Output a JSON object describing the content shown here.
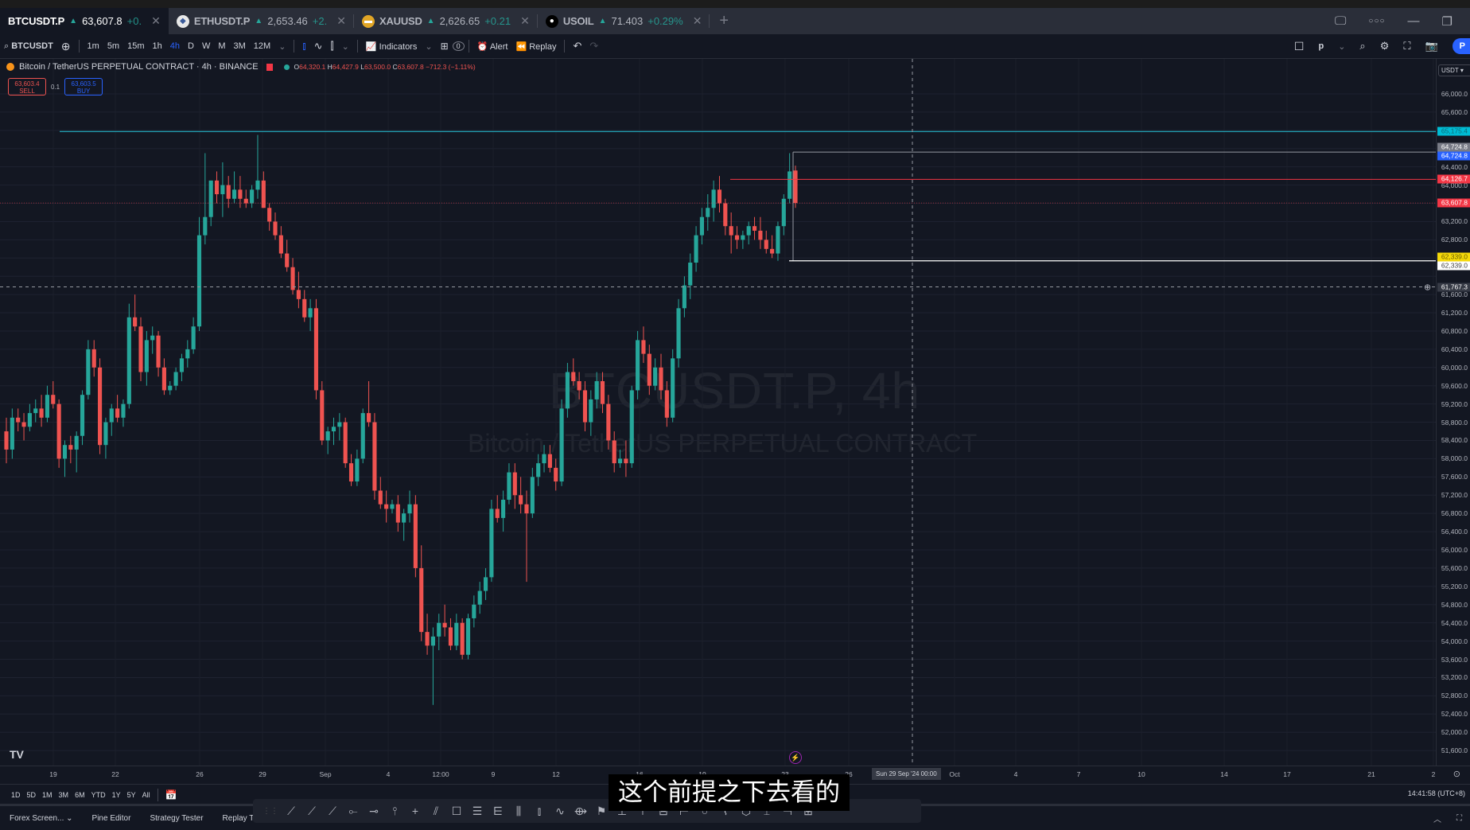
{
  "tabs": [
    {
      "symbol": "BTCUSDT.P",
      "price": "63,607.8",
      "change": "+0.",
      "active": true,
      "icon": "bitcoin-icon"
    },
    {
      "symbol": "ETHUSDT.P",
      "price": "2,653.46",
      "change": "+2.",
      "active": false,
      "icon": "ethereum-icon"
    },
    {
      "symbol": "XAUUSD",
      "price": "2,626.65",
      "change": "+0.21",
      "active": false,
      "icon": "gold-icon"
    },
    {
      "symbol": "USOIL",
      "price": "71.403",
      "change": "+0.29%",
      "active": false,
      "icon": "oil-drop-icon"
    }
  ],
  "toolbar": {
    "symbol_search": "BTCUSDT",
    "intervals": [
      "1m",
      "5m",
      "15m",
      "1h",
      "4h",
      "D",
      "W",
      "M",
      "3M",
      "12M"
    ],
    "active_interval": "4h",
    "indicators_label": "Indicators",
    "alert_label": "Alert",
    "replay_label": "Replay",
    "layout_label": "p",
    "publish_label": "P",
    "templates_count": "0"
  },
  "legend": {
    "title": "Bitcoin / TetherUS PERPETUAL CONTRACT · 4h · BINANCE",
    "open_label": "O",
    "open": "64,320.1",
    "high_label": "H",
    "high": "64,427.9",
    "low_label": "L",
    "low": "63,500.0",
    "close_label": "C",
    "close": "63,607.8",
    "change": "−712.3 (−1.11%)"
  },
  "trade": {
    "sell_price": "63,603.4",
    "sell_label": "SELL",
    "spread": "0.1",
    "buy_price": "63,603.5",
    "buy_label": "BUY"
  },
  "watermark": {
    "symbol": "BTCUSDT.P, 4h",
    "description": "Bitcoin / TetherUS PERPETUAL CONTRACT"
  },
  "price_axis": {
    "currency": "USDT",
    "ticks": [
      "66,000.0",
      "65,600.0",
      "64,400.0",
      "64,000.0",
      "63,200.0",
      "62,800.0",
      "61,600.0",
      "61,200.0",
      "60,800.0",
      "60,400.0",
      "60,000.0",
      "59,600.0",
      "59,200.0",
      "58,800.0",
      "58,400.0",
      "58,000.0",
      "57,600.0",
      "57,200.0",
      "56,800.0",
      "56,400.0",
      "56,000.0",
      "55,600.0",
      "55,200.0",
      "54,800.0",
      "54,400.0",
      "54,000.0",
      "53,600.0",
      "53,200.0",
      "52,800.0",
      "52,400.0",
      "52,000.0",
      "51,600.0"
    ],
    "tags": [
      {
        "value": "65,175.4",
        "color": "#00bcd4",
        "text_color": "#0b6b78"
      },
      {
        "value": "64,724.8",
        "color": "#787b86",
        "text_color": "#ffffff"
      },
      {
        "value": "64,724.8",
        "color": "#2962ff",
        "text_color": "#ffffff"
      },
      {
        "value": "64,126.7",
        "color": "#f23645",
        "text_color": "#ffffff"
      },
      {
        "value": "63,607.8",
        "color": "#f23645",
        "text_color": "#ffffff"
      },
      {
        "value": "62,339.0",
        "color": "#f5d90a",
        "text_color": "#6b5e00"
      },
      {
        "value": "62,339.0",
        "color": "#ffffff",
        "text_color": "#444444"
      },
      {
        "value": "61,767.3",
        "color": "#363a45",
        "text_color": "#ffffff"
      }
    ]
  },
  "time_axis": {
    "ticks": [
      "19",
      "22",
      "26",
      "29",
      "Sep",
      "4",
      "12:00",
      "9",
      "12",
      "16",
      "19",
      "23",
      "26",
      "Oct",
      "4",
      "7",
      "10",
      "14",
      "17",
      "21",
      "2"
    ],
    "crosshair_label": "Sun 29 Sep '24   00:00"
  },
  "range_bar": {
    "ranges": [
      "1D",
      "5D",
      "1M",
      "3M",
      "6M",
      "YTD",
      "1Y",
      "5Y",
      "All"
    ],
    "clock": "14:41:58 (UTC+8)"
  },
  "bottom_bar": {
    "panels": [
      "Forex Screen...",
      "Pine Editor",
      "Strategy Tester",
      "Replay Tr..."
    ]
  },
  "subtitle": "这个前提之下去看的",
  "colors": {
    "up": "#26a69a",
    "down": "#ef5350",
    "background": "#131722",
    "accent": "#2962ff"
  },
  "chart_data": {
    "type": "candlestick",
    "title": "BTCUSDT.P, 4h",
    "ylim": [
      51400,
      66400
    ],
    "current_price": 63607.8,
    "horizontal_lines": [
      65175.4,
      64724.8,
      64126.7,
      62339.0,
      61767.3
    ],
    "candles_approx": [
      [
        58600,
        58900,
        57900,
        58200
      ],
      [
        58200,
        59100,
        58000,
        58900
      ],
      [
        58900,
        59100,
        58600,
        58800
      ],
      [
        58800,
        59000,
        58400,
        58700
      ],
      [
        58700,
        59200,
        58600,
        59000
      ],
      [
        59000,
        59300,
        58800,
        59100
      ],
      [
        59100,
        59400,
        58700,
        58900
      ],
      [
        58900,
        59600,
        58800,
        59400
      ],
      [
        59400,
        59700,
        59100,
        59200
      ],
      [
        59200,
        59300,
        57800,
        58000
      ],
      [
        58000,
        58400,
        57600,
        58300
      ],
      [
        58300,
        58500,
        57900,
        58200
      ],
      [
        58200,
        58600,
        57700,
        58500
      ],
      [
        58500,
        59500,
        58300,
        59400
      ],
      [
        59400,
        60600,
        59300,
        60400
      ],
      [
        60400,
        60600,
        59800,
        60000
      ],
      [
        60000,
        60200,
        58100,
        58300
      ],
      [
        58300,
        58900,
        58000,
        58800
      ],
      [
        58800,
        59200,
        58500,
        59100
      ],
      [
        59100,
        59400,
        58800,
        58900
      ],
      [
        58900,
        59300,
        58700,
        59200
      ],
      [
        59200,
        61400,
        59100,
        61100
      ],
      [
        61100,
        61600,
        60800,
        60900
      ],
      [
        60900,
        61100,
        59700,
        59900
      ],
      [
        59900,
        60800,
        59600,
        60600
      ],
      [
        60600,
        60900,
        60300,
        60700
      ],
      [
        60700,
        60800,
        59800,
        60000
      ],
      [
        60000,
        60200,
        59400,
        59500
      ],
      [
        59500,
        59700,
        59400,
        59600
      ],
      [
        59600,
        60000,
        59500,
        59900
      ],
      [
        59900,
        60300,
        59700,
        60200
      ],
      [
        60200,
        60600,
        60000,
        60400
      ],
      [
        60400,
        61100,
        60300,
        60900
      ],
      [
        60900,
        63300,
        60800,
        62900
      ],
      [
        62900,
        64700,
        62700,
        63300
      ],
      [
        63300,
        64100,
        63100,
        64100
      ],
      [
        64100,
        64300,
        63600,
        63800
      ],
      [
        63800,
        64500,
        63300,
        64000
      ],
      [
        64000,
        64200,
        63500,
        63700
      ],
      [
        63700,
        64300,
        63600,
        63900
      ],
      [
        63900,
        64200,
        63500,
        63700
      ],
      [
        63700,
        63900,
        63500,
        63600
      ],
      [
        63600,
        64000,
        63500,
        63900
      ],
      [
        63900,
        65100,
        63700,
        64100
      ],
      [
        64100,
        64300,
        63500,
        63500
      ],
      [
        63500,
        63600,
        63000,
        63200
      ],
      [
        63200,
        63400,
        62800,
        62900
      ],
      [
        62900,
        63100,
        62400,
        62500
      ],
      [
        62500,
        62800,
        62100,
        62200
      ],
      [
        62200,
        62400,
        61600,
        61700
      ],
      [
        61700,
        62100,
        61300,
        61500
      ],
      [
        61500,
        61700,
        61000,
        61100
      ],
      [
        61100,
        61500,
        60800,
        61300
      ],
      [
        61300,
        61500,
        59300,
        59500
      ],
      [
        59500,
        59700,
        58300,
        58400
      ],
      [
        58400,
        58700,
        58100,
        58600
      ],
      [
        58600,
        58900,
        58300,
        58700
      ],
      [
        58700,
        59000,
        58400,
        58800
      ],
      [
        58800,
        58900,
        57800,
        57900
      ],
      [
        57900,
        58100,
        57400,
        57500
      ],
      [
        57500,
        58200,
        57400,
        58000
      ],
      [
        58000,
        59100,
        57900,
        59000
      ],
      [
        59000,
        59700,
        58700,
        58800
      ],
      [
        58800,
        59000,
        57100,
        57300
      ],
      [
        57300,
        57600,
        56900,
        57000
      ],
      [
        57000,
        57300,
        56600,
        56900
      ],
      [
        56900,
        57100,
        56800,
        57000
      ],
      [
        57000,
        57200,
        56400,
        56600
      ],
      [
        56600,
        56900,
        56200,
        56800
      ],
      [
        56800,
        57300,
        56600,
        57000
      ],
      [
        57000,
        57200,
        55400,
        55600
      ],
      [
        55600,
        56100,
        54000,
        54200
      ],
      [
        54200,
        54600,
        53700,
        53900
      ],
      [
        53900,
        54300,
        52600,
        54100
      ],
      [
        54100,
        54600,
        53800,
        54400
      ],
      [
        54400,
        54800,
        54100,
        54300
      ],
      [
        54300,
        54500,
        53800,
        53900
      ],
      [
        53900,
        54600,
        53800,
        54400
      ],
      [
        54400,
        54500,
        53600,
        53700
      ],
      [
        53700,
        54600,
        53600,
        54500
      ],
      [
        54500,
        55000,
        54300,
        54800
      ],
      [
        54800,
        55300,
        54600,
        55100
      ],
      [
        55100,
        55600,
        54900,
        55400
      ],
      [
        55400,
        57100,
        55300,
        56900
      ],
      [
        56900,
        57200,
        56600,
        56700
      ],
      [
        56700,
        57300,
        56400,
        57100
      ],
      [
        57100,
        57900,
        57000,
        57700
      ],
      [
        57700,
        57900,
        56900,
        57200
      ],
      [
        57200,
        57600,
        56800,
        57000
      ],
      [
        57000,
        57300,
        55300,
        56800
      ],
      [
        56800,
        57800,
        56700,
        57600
      ],
      [
        57600,
        58100,
        57400,
        57900
      ],
      [
        57900,
        58300,
        57700,
        58100
      ],
      [
        58100,
        58300,
        57700,
        57800
      ],
      [
        57800,
        58000,
        57300,
        57500
      ],
      [
        57500,
        59300,
        57400,
        59100
      ],
      [
        59100,
        60100,
        58900,
        59900
      ],
      [
        59900,
        60200,
        59600,
        59700
      ],
      [
        59700,
        59900,
        59300,
        59500
      ],
      [
        59500,
        59700,
        58600,
        58800
      ],
      [
        58800,
        59500,
        58500,
        59300
      ],
      [
        59300,
        59900,
        59100,
        59700
      ],
      [
        59700,
        59900,
        59000,
        59200
      ],
      [
        59200,
        59400,
        58200,
        58400
      ],
      [
        58400,
        58600,
        57700,
        57900
      ],
      [
        57900,
        58200,
        57800,
        58000
      ],
      [
        58000,
        58400,
        57600,
        57900
      ],
      [
        57900,
        59600,
        57800,
        59500
      ],
      [
        59500,
        60800,
        59300,
        60600
      ],
      [
        60600,
        60900,
        60100,
        60300
      ],
      [
        60300,
        60500,
        59400,
        59600
      ],
      [
        59600,
        60200,
        59500,
        60000
      ],
      [
        60000,
        60300,
        59300,
        59500
      ],
      [
        59500,
        59700,
        58700,
        58900
      ],
      [
        58900,
        60400,
        58800,
        60200
      ],
      [
        60200,
        61500,
        60000,
        61300
      ],
      [
        61300,
        62000,
        61100,
        61800
      ],
      [
        61800,
        62500,
        61500,
        62300
      ],
      [
        62300,
        63100,
        62100,
        62900
      ],
      [
        62900,
        63500,
        62700,
        63300
      ],
      [
        63300,
        63800,
        63000,
        63500
      ],
      [
        63500,
        64100,
        63200,
        63900
      ],
      [
        63900,
        64200,
        63400,
        63600
      ],
      [
        63600,
        63700,
        62900,
        63100
      ],
      [
        63100,
        63400,
        62500,
        62900
      ],
      [
        62900,
        63100,
        62600,
        62800
      ],
      [
        62800,
        63000,
        62600,
        62900
      ],
      [
        62900,
        63200,
        62700,
        63100
      ],
      [
        63100,
        63300,
        62800,
        63000
      ],
      [
        63000,
        63300,
        62600,
        62800
      ],
      [
        62800,
        63000,
        62500,
        62600
      ],
      [
        62600,
        62900,
        62400,
        62500
      ],
      [
        62500,
        63200,
        62339,
        63100
      ],
      [
        63100,
        63800,
        62900,
        63700
      ],
      [
        63700,
        64700,
        63600,
        64300
      ],
      [
        64320.1,
        64427.9,
        63500.0,
        63607.8
      ]
    ]
  }
}
